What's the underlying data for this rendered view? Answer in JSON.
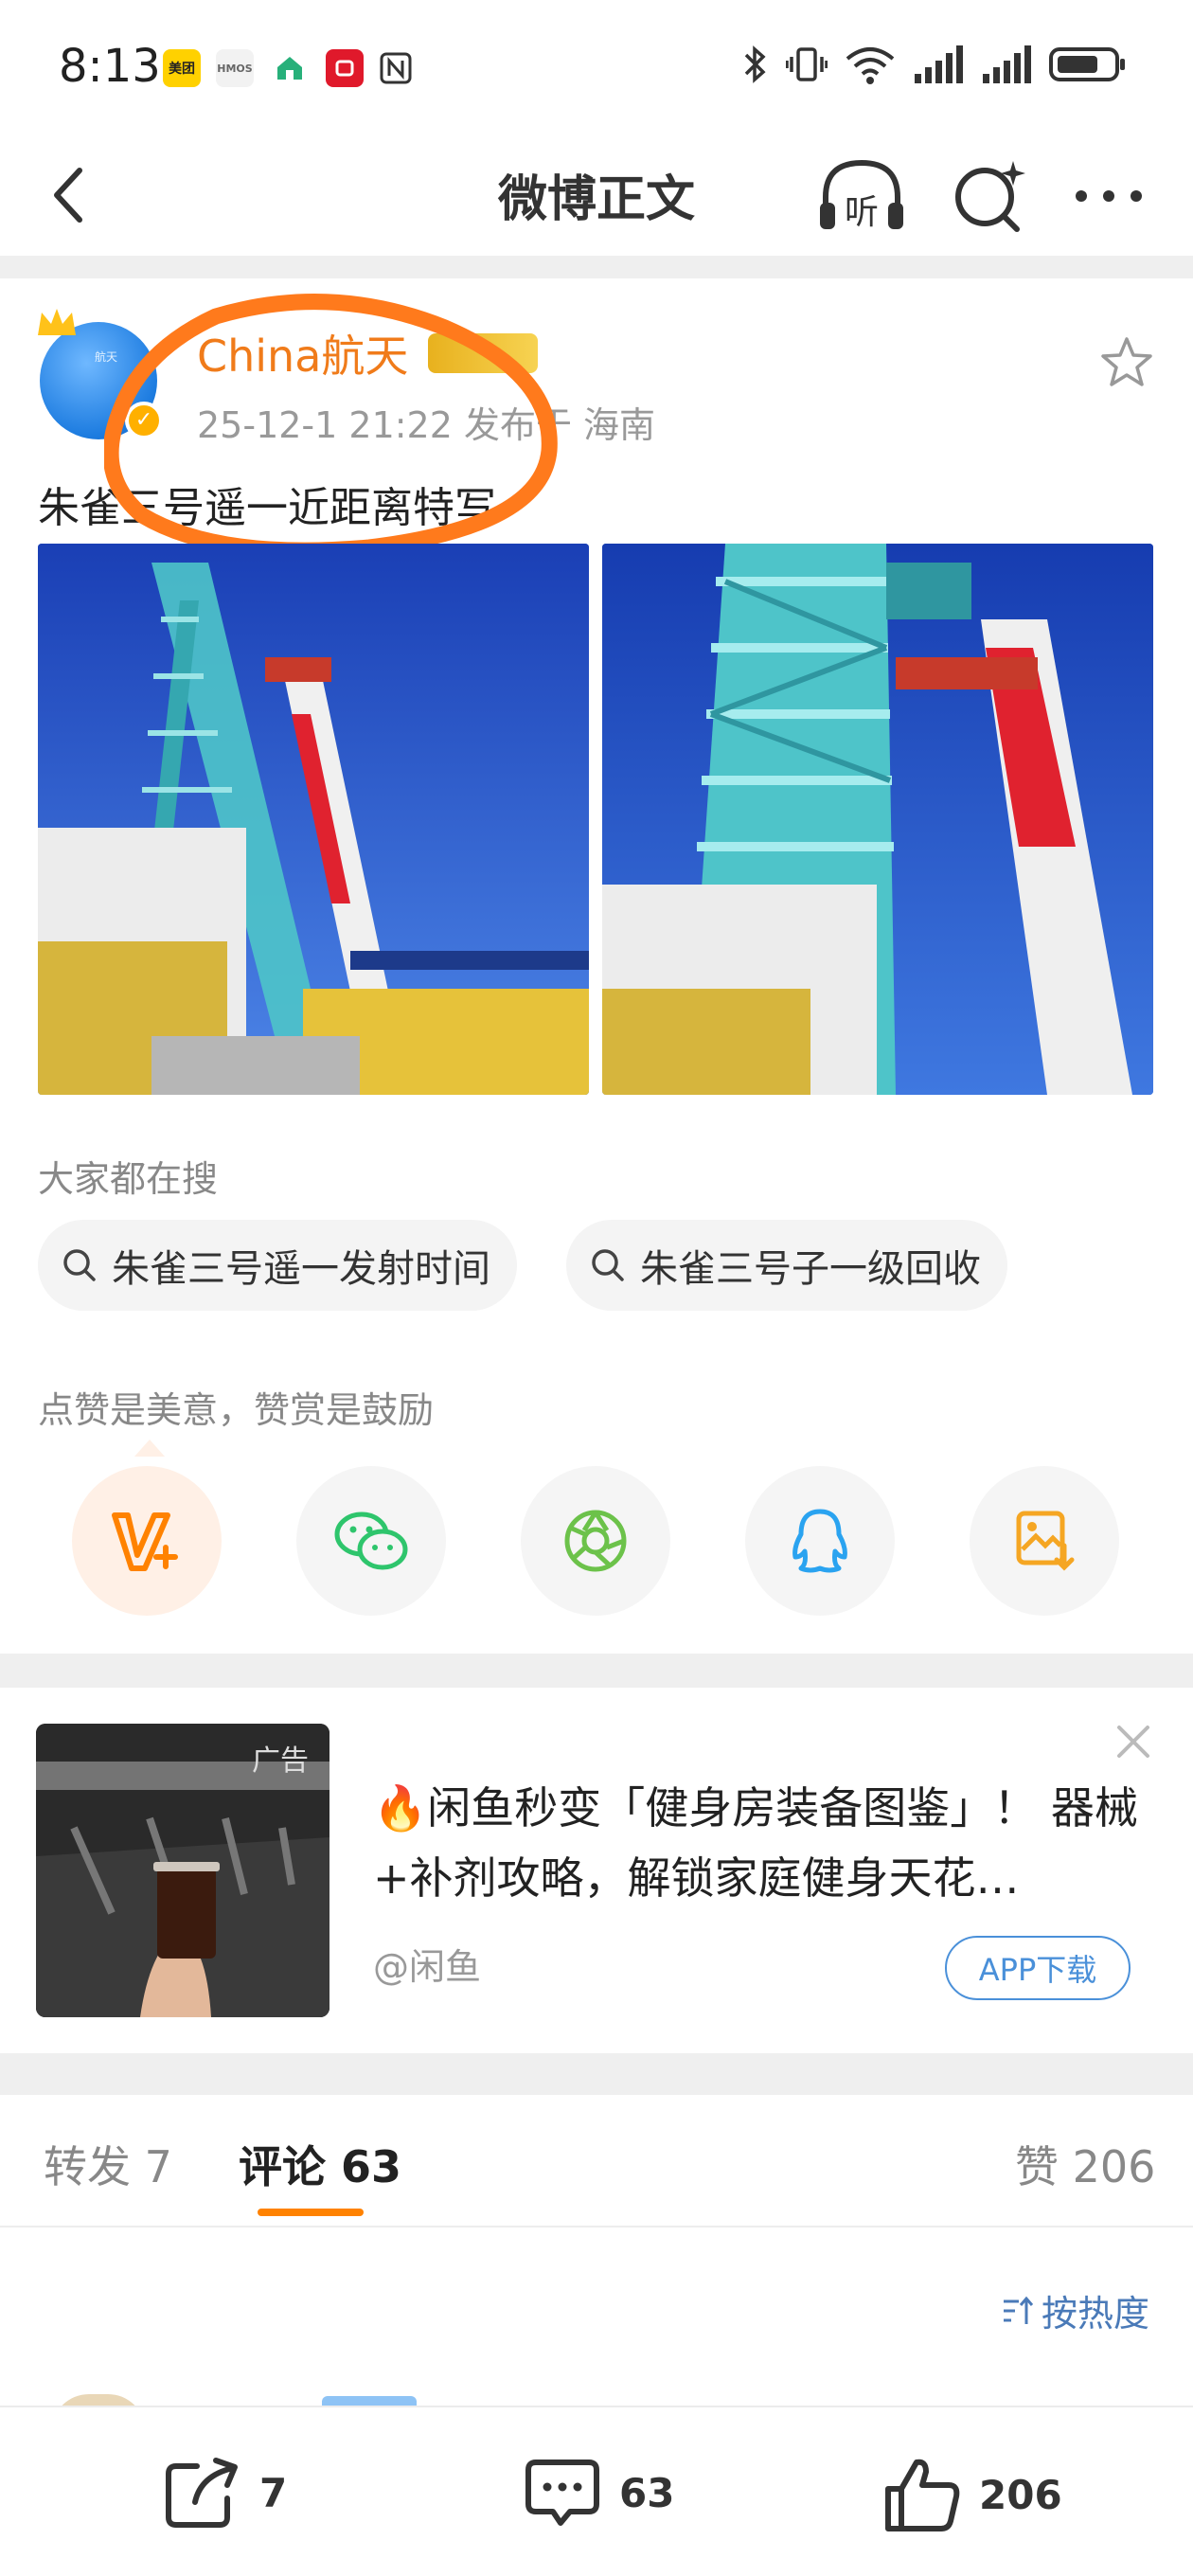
{
  "status_bar": {
    "time": "8:13",
    "apps": [
      {
        "icon": "meituan-app-icon",
        "label": "美团",
        "color": "#ffd100"
      },
      {
        "icon": "hmos-app-icon",
        "label": "HMOS",
        "color": "#f2f2f2"
      },
      {
        "icon": "home-app-icon",
        "label": "",
        "color": "#ffffff"
      },
      {
        "icon": "securities-app-icon",
        "label": "方正证券",
        "color": "#e0192b"
      },
      {
        "icon": "nfc-icon",
        "label": "",
        "color": "#ffffff"
      }
    ],
    "icons": [
      "bluetooth-icon",
      "vibrate-icon",
      "wifi-icon",
      "signal-icon",
      "signal-icon",
      "battery-icon"
    ]
  },
  "navbar": {
    "title": "微博正文",
    "listen_label": "听",
    "icons": [
      "back-icon",
      "listen-icon",
      "search-icon",
      "more-icon"
    ]
  },
  "post": {
    "username": "China航天",
    "meta": "25-12-1 21:22  发布于 海南",
    "text": "朱雀三号遥一近距离特写",
    "avatar_text": "航天",
    "username_color": "#f07b1a"
  },
  "search_section": {
    "label": "大家都在搜",
    "chips": [
      "朱雀三号遥一发射时间",
      "朱雀三号子一级回收"
    ]
  },
  "reward_section": {
    "label": "点赞是美意，赞赏是鼓励",
    "share_icons": [
      "reward-v-icon",
      "wechat-icon",
      "moments-icon",
      "qq-icon",
      "save-image-icon"
    ]
  },
  "ad": {
    "tag": "广告",
    "emoji": "🔥",
    "title": "闲鱼秒变「健身房装备图鉴」！ 器械+补剂攻略，解锁家庭健身天花…",
    "source": "@闲鱼",
    "button": "APP下载"
  },
  "tabs": {
    "repost": "转发 7",
    "comment_label": "评论",
    "comment_count": "63",
    "likes": "赞 206",
    "sort": "按热度",
    "accent": "#ff8200"
  },
  "bottom_bar": {
    "repost_count": "7",
    "comment_count": "63",
    "like_count": "206"
  }
}
